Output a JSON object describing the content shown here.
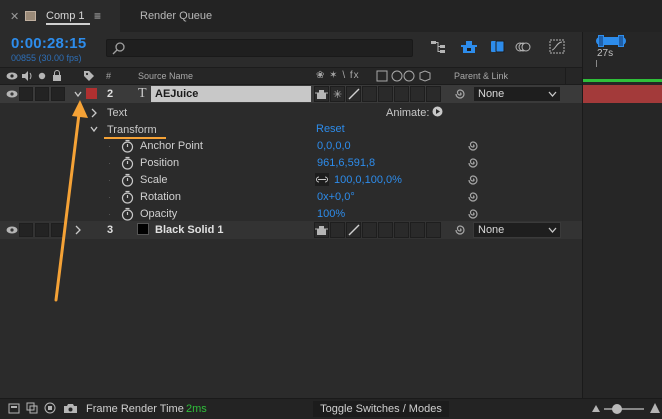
{
  "tabs": {
    "comp_tab_label": "Comp 1",
    "render_queue_label": "Render Queue"
  },
  "timecode": {
    "time": "0:00:28:15",
    "frames": "00855 (30.00 fps)"
  },
  "search": {
    "placeholder": ""
  },
  "ruler": {
    "label": "27s"
  },
  "columns": {
    "num": "#",
    "source_name": "Source Name",
    "switches": "❀ ✶ \\ fx",
    "parent_link": "Parent & Link"
  },
  "layers": [
    {
      "num": "2",
      "name": "AEJuice",
      "label_color": "#b03030",
      "parent": "None"
    },
    {
      "num": "3",
      "name": "Black Solid 1",
      "label_color": "#000000",
      "parent": "None"
    }
  ],
  "text_group": {
    "label": "Text",
    "animate_label": "Animate:"
  },
  "transform": {
    "label": "Transform",
    "reset_label": "Reset",
    "properties": [
      {
        "name": "Anchor Point",
        "value": "0,0,0,0"
      },
      {
        "name": "Position",
        "value": "961,6,591,8"
      },
      {
        "name": "Scale",
        "value": "100,0,100,0%"
      },
      {
        "name": "Rotation",
        "value": "0x+0,0°"
      },
      {
        "name": "Opacity",
        "value": "100%"
      }
    ]
  },
  "bottom": {
    "frame_render_label": "Frame Render Time",
    "frame_render_value": "2ms",
    "toggle_label": "Toggle Switches / Modes"
  },
  "colors": {
    "accent_blue": "#2d8ceb",
    "annotation_orange": "#f5a236",
    "track_red": "#a33a3a",
    "workarea_green": "#2fbf3a"
  }
}
